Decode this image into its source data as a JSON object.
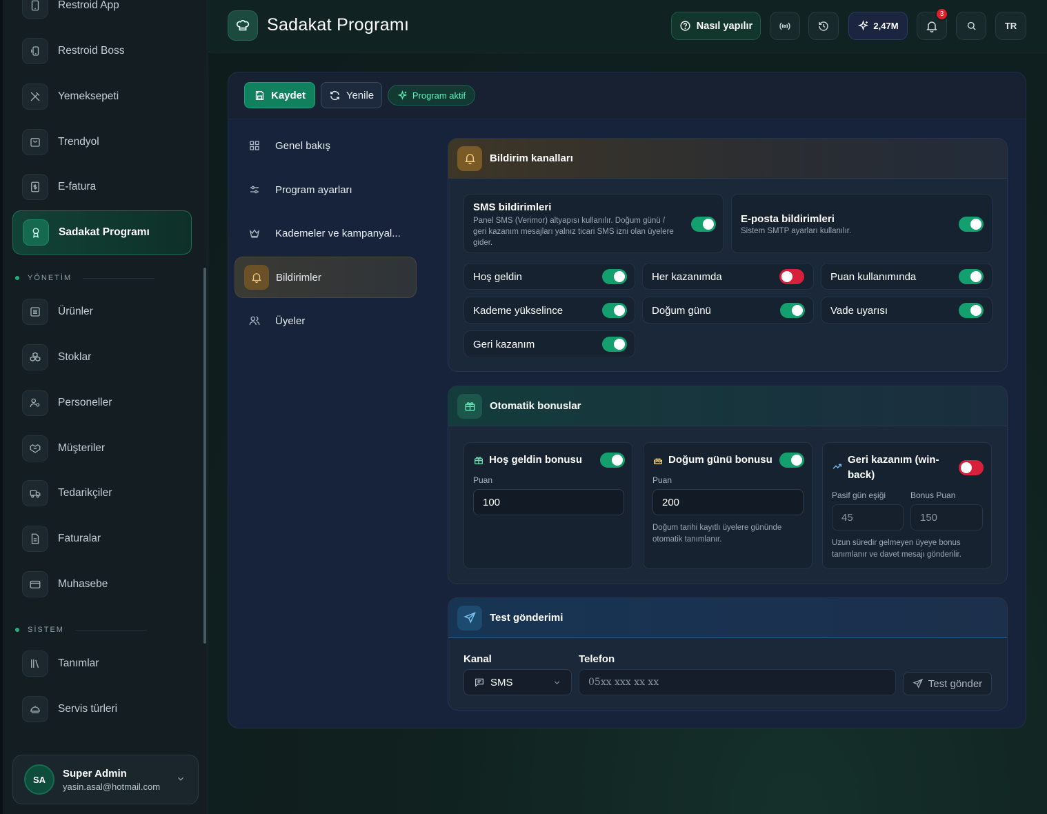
{
  "sidebar": {
    "items_top": [
      {
        "label": "Restroid App",
        "icon": "tablet-icon"
      },
      {
        "label": "Restroid Boss",
        "icon": "tablet-rotate-icon"
      },
      {
        "label": "Yemeksepeti",
        "icon": "utensils-cross-icon"
      },
      {
        "label": "Trendyol",
        "icon": "shopping-bag-icon"
      },
      {
        "label": "E-fatura",
        "icon": "invoice-dollar-icon"
      },
      {
        "label": "Sadakat Programı",
        "icon": "award-ribbon-icon",
        "active": true
      }
    ],
    "section_management": "YÖNETİM",
    "items_management": [
      {
        "label": "Ürünler",
        "icon": "list-icon"
      },
      {
        "label": "Stoklar",
        "icon": "boxes-icon"
      },
      {
        "label": "Personeller",
        "icon": "users-gear-icon"
      },
      {
        "label": "Müşteriler",
        "icon": "handshake-icon"
      },
      {
        "label": "Tedarikçiler",
        "icon": "truck-icon"
      },
      {
        "label": "Faturalar",
        "icon": "document-icon"
      },
      {
        "label": "Muhasebe",
        "icon": "wallet-icon"
      }
    ],
    "section_system": "SİSTEM",
    "items_system": [
      {
        "label": "Tanımlar",
        "icon": "library-icon"
      },
      {
        "label": "Servis türleri",
        "icon": "cloche-icon"
      }
    ],
    "user": {
      "initials": "SA",
      "name": "Super Admin",
      "email": "yasin.asal@hotmail.com"
    }
  },
  "header": {
    "title": "Sadakat Programı",
    "help_label": "Nasıl yapılır",
    "credits": "2,47M",
    "notification_count": "3",
    "language": "TR"
  },
  "toolbar": {
    "save_label": "Kaydet",
    "refresh_label": "Yenile",
    "status_label": "Program aktif"
  },
  "submenu": [
    {
      "label": "Genel bakış",
      "icon": "grid-icon"
    },
    {
      "label": "Program ayarları",
      "icon": "sliders-icon"
    },
    {
      "label": "Kademeler ve kampanyal...",
      "icon": "crown-icon"
    },
    {
      "label": "Bildirimler",
      "icon": "bell-icon",
      "active": true
    },
    {
      "label": "Üyeler",
      "icon": "users-icon"
    }
  ],
  "notification_channels": {
    "title": "Bildirim kanalları",
    "sms": {
      "title": "SMS bildirimleri",
      "desc_line1": "Panel SMS (Verimor) altyapısı kullanılır. Doğum günü /",
      "desc_line2": "geri kazanım mesajları yalnız ticari SMS izni olan üyelere",
      "desc_line3": "gider.",
      "enabled": true
    },
    "email": {
      "title": "E-posta bildirimleri",
      "desc": "Sistem SMTP ayarları kullanılır.",
      "enabled": true
    },
    "events": [
      {
        "label": "Hoş geldin",
        "enabled": true
      },
      {
        "label": "Her kazanımda",
        "enabled": false
      },
      {
        "label": "Puan kullanımında",
        "enabled": true
      },
      {
        "label": "Kademe yükselince",
        "enabled": true
      },
      {
        "label": "Doğum günü",
        "enabled": true
      },
      {
        "label": "Vade uyarısı",
        "enabled": true
      },
      {
        "label": "Geri kazanım",
        "enabled": true
      }
    ]
  },
  "auto_bonuses": {
    "title": "Otomatik bonuslar",
    "welcome": {
      "title": "Hoş geldin bonusu",
      "points_label": "Puan",
      "points": "100",
      "enabled": true
    },
    "birthday": {
      "title": "Doğum günü bonusu",
      "points_label": "Puan",
      "points": "200",
      "enabled": true,
      "note_line1": "Doğum tarihi kayıtlı üyelere gününde",
      "note_line2": "otomatik tanımlanır."
    },
    "winback": {
      "title_line1": "Geri kazanım (win-",
      "title_line2": "back)",
      "enabled": false,
      "days_label": "Pasif gün eşiği",
      "days": "45",
      "bonus_label": "Bonus Puan",
      "bonus": "150",
      "note_line1": "Uzun süredir gelmeyen üyeye bonus",
      "note_line2": "tanımlanır ve davet mesajı gönderilir."
    }
  },
  "test_send": {
    "title": "Test gönderimi",
    "channel_label": "Kanal",
    "channel_value": "SMS",
    "phone_label": "Telefon",
    "phone_placeholder": "05xx xxx xx xx",
    "send_label": "Test gönder"
  },
  "colors": {
    "accent_green": "#13a06e",
    "toggle_off": "#d7213c",
    "amber": "#f5cd80",
    "panel_bg": "#17233a"
  }
}
